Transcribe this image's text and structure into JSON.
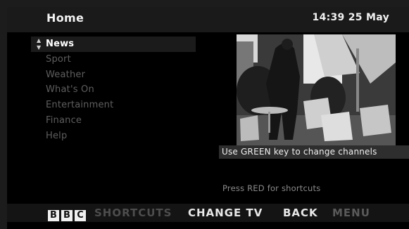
{
  "header": {
    "title": "Home",
    "time": "14:39 25 May"
  },
  "menu": {
    "selected_indicator": "▲▼",
    "items": [
      {
        "label": "News",
        "selected": true
      },
      {
        "label": "Sport",
        "selected": false
      },
      {
        "label": "Weather",
        "selected": false
      },
      {
        "label": "What's On",
        "selected": false
      },
      {
        "label": "Entertainment",
        "selected": false
      },
      {
        "label": "Finance",
        "selected": false
      },
      {
        "label": "Help",
        "selected": false
      }
    ]
  },
  "hints": {
    "green": "Use GREEN key to change channels",
    "red": "Press RED for shortcuts"
  },
  "footer": {
    "logo": [
      "B",
      "B",
      "C"
    ],
    "shortcuts": "SHORTCUTS",
    "change_tv": "CHANGE TV",
    "back": "BACK",
    "menu": "MENU"
  }
}
